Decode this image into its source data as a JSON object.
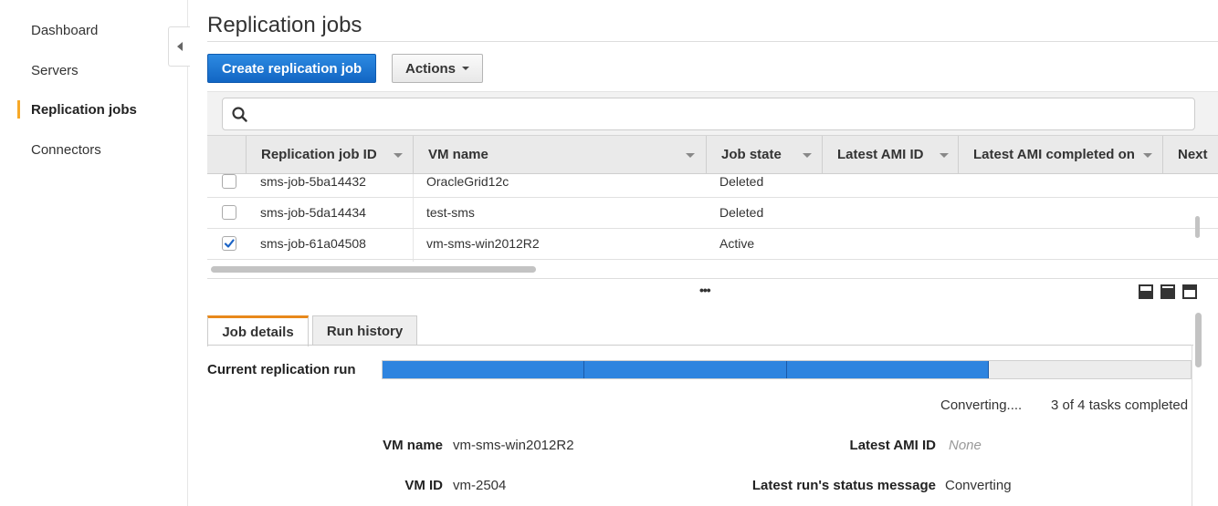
{
  "sidebar": {
    "items": [
      {
        "label": "Dashboard"
      },
      {
        "label": "Servers"
      },
      {
        "label": "Replication jobs"
      },
      {
        "label": "Connectors"
      }
    ]
  },
  "page": {
    "title": "Replication jobs"
  },
  "toolbar": {
    "create_label": "Create replication job",
    "actions_label": "Actions"
  },
  "search": {
    "placeholder": "",
    "value": ""
  },
  "table": {
    "columns": [
      "Replication job ID",
      "VM name",
      "Job state",
      "Latest AMI ID",
      "Latest AMI completed on",
      "Next"
    ],
    "rows": [
      {
        "id": "sms-job-5ba14432",
        "vm": "OracleGrid12c",
        "state": "Deleted",
        "checked": false
      },
      {
        "id": "sms-job-5da14434",
        "vm": "test-sms",
        "state": "Deleted",
        "checked": false
      },
      {
        "id": "sms-job-61a04508",
        "vm": "vm-sms-win2012R2",
        "state": "Active",
        "checked": true
      }
    ]
  },
  "tabs": [
    {
      "label": "Job details",
      "active": true
    },
    {
      "label": "Run history",
      "active": false
    }
  ],
  "run": {
    "label": "Current replication run",
    "status_text": "Converting....",
    "tasks_text": "3 of 4 tasks completed",
    "completed_tasks": 3,
    "total_tasks": 4
  },
  "details": {
    "vm_name_label": "VM name",
    "vm_name_value": "vm-sms-win2012R2",
    "vm_id_label": "VM ID",
    "vm_id_value": "vm-2504",
    "latest_ami_label": "Latest AMI ID",
    "latest_ami_value": "None",
    "status_msg_label": "Latest run's status message",
    "status_msg_value": "Converting"
  },
  "colors": {
    "accent": "#f7a928",
    "primary": "#1f77d0",
    "progress": "#2e84df",
    "tab_active": "#e8891b"
  }
}
